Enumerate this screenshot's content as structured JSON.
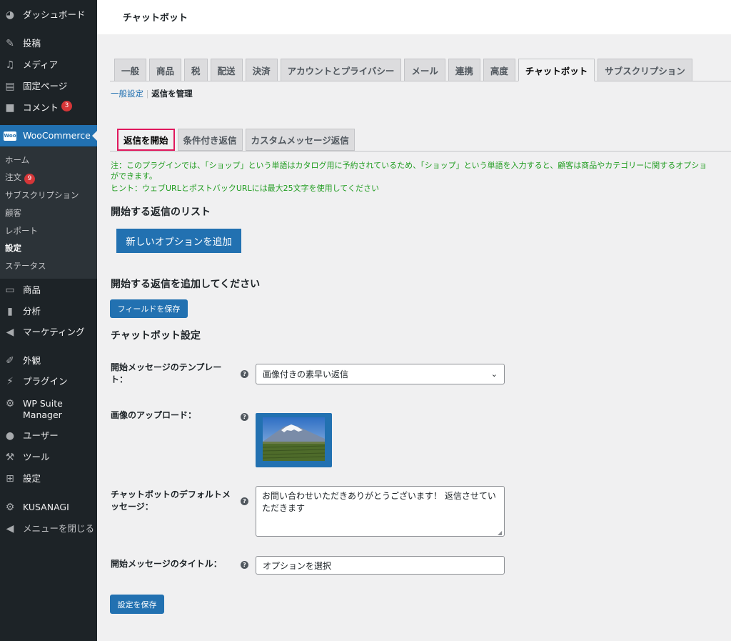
{
  "sidebar": {
    "items": [
      {
        "label": "ダッシュボード",
        "icon": "dashboard-icon"
      },
      {
        "label": "投稿",
        "icon": "pin-icon"
      },
      {
        "label": "メディア",
        "icon": "media-icon"
      },
      {
        "label": "固定ページ",
        "icon": "page-icon"
      },
      {
        "label": "コメント",
        "icon": "comment-icon",
        "badge": "3"
      },
      {
        "label": "WooCommerce",
        "icon": "woocommerce-icon"
      },
      {
        "label": "商品",
        "icon": "archive-icon"
      },
      {
        "label": "分析",
        "icon": "chart-bar-icon"
      },
      {
        "label": "マーケティング",
        "icon": "megaphone-icon"
      },
      {
        "label": "外観",
        "icon": "brush-icon"
      },
      {
        "label": "プラグイン",
        "icon": "plugin-icon"
      },
      {
        "label": "WP Suite Manager",
        "icon": "gear-icon"
      },
      {
        "label": "ユーザー",
        "icon": "user-icon"
      },
      {
        "label": "ツール",
        "icon": "wrench-icon"
      },
      {
        "label": "設定",
        "icon": "settings-icon"
      },
      {
        "label": "KUSANAGI",
        "icon": "gear-icon"
      },
      {
        "label": "メニューを閉じる",
        "icon": "collapse-icon"
      }
    ],
    "submenu": [
      {
        "label": "ホーム"
      },
      {
        "label": "注文",
        "badge": "9"
      },
      {
        "label": "サブスクリプション"
      },
      {
        "label": "顧客"
      },
      {
        "label": "レポート"
      },
      {
        "label": "設定",
        "current": true
      },
      {
        "label": "ステータス"
      }
    ],
    "woo_logo_text": "Woo"
  },
  "header": {
    "title": "チャットボット"
  },
  "nav_tabs": [
    "一般",
    "商品",
    "税",
    "配送",
    "決済",
    "アカウントとプライバシー",
    "メール",
    "連携",
    "高度",
    "チャットボット",
    "サブスクリプション"
  ],
  "breadcrumb": {
    "link": "一般設定",
    "separator": "|",
    "current": "返信を管理"
  },
  "inner_tabs": [
    "返信を開始",
    "条件付き返信",
    "カスタムメッセージ返信"
  ],
  "notice": {
    "line1": "注：このプラグインでは、「ショップ」という単語はカタログ用に予約されているため、「ショップ」という単語を入力すると、顧客は商品やカテゴリーに関するオプショ",
    "line2": "ができます。",
    "line3": "ヒント：ウェブURLとポストバックURLには最大25文字を使用してください"
  },
  "sections": {
    "list_title": "開始する返信のリスト",
    "add_option_button": "新しいオプションを追加",
    "add_title": "開始する返信を追加してください",
    "save_fields_button": "フィールドを保存",
    "settings_title": "チャットボット設定"
  },
  "form": {
    "template_label_1": "開始メッセージのテンプレー",
    "template_label_2": "ト：",
    "template_value": "画像付きの素早い返信",
    "image_label": "画像のアップロード：",
    "default_msg_label_1": "チャットボットのデフォルトメ",
    "default_msg_label_2": "ッセージ：",
    "default_msg_value": "お問い合わせいただきありがとうございます！ 返信させていただきます",
    "title_label": "開始メッセージのタイトル：",
    "title_value": "オプションを選択",
    "help_glyph": "?",
    "save_settings_button": "設定を保存"
  },
  "colors": {
    "sidebar_bg": "#1d2327",
    "accent": "#2271b1",
    "notice_green": "#1f9c1f",
    "highlight": "#e0185d"
  }
}
